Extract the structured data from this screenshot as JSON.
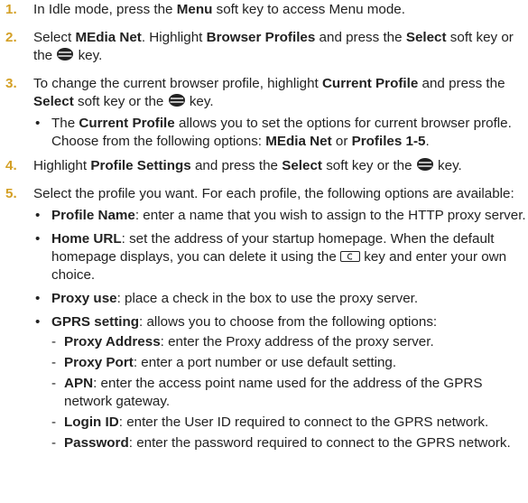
{
  "steps": [
    {
      "num": "1.",
      "t1": "In Idle mode, press the ",
      "b1": "Menu",
      "t2": " soft key to access Menu mode."
    },
    {
      "num": "2.",
      "t1": "Select ",
      "b1": "MEdia Net",
      "t2": ". Highlight ",
      "b2": "Browser Profiles",
      "t3": " and press the ",
      "b3": "Select",
      "t4": " soft key or the ",
      "t5": " key."
    },
    {
      "num": "3.",
      "t1": "To change the current browser profile, highlight ",
      "b1": "Current Profile",
      "t2": " and press the ",
      "b2": "Select",
      "t3": " soft key or the ",
      "t4": " key."
    },
    {
      "num": "4.",
      "t1": "Highlight ",
      "b1": "Profile Settings",
      "t2": " and press the ",
      "b2": "Select",
      "t3": " soft key or the ",
      "t4": " key."
    },
    {
      "num": "5.",
      "t1": "Select the profile you want. For each profile, the following options are available:"
    }
  ],
  "step3_bullet": {
    "t1": "The ",
    "b1": "Current Profile",
    "t2": " allows you to set the options for current browser profle. Choose from the following options: ",
    "b2": "MEdia Net",
    "t3": " or ",
    "b3": "Profiles 1-5",
    "t4": "."
  },
  "step5_bullets": [
    {
      "label": "Profile Name",
      "text": ": enter a name that you wish to assign to the HTTP proxy server."
    },
    {
      "label": "Home URL",
      "text": ": set the address of your startup homepage. When the default homepage displays, you can delete it using the ",
      "text2": " key and enter your own choice."
    },
    {
      "label": "Proxy use",
      "text": ": place a check in the box to use the proxy server."
    },
    {
      "label": "GPRS setting",
      "text": ": allows you to choose from the following options:"
    }
  ],
  "gprs_options": [
    {
      "label": "Proxy Address",
      "text": ": enter the Proxy address of the proxy server."
    },
    {
      "label": "Proxy Port",
      "text": ": enter a port number or use default setting."
    },
    {
      "label": "APN",
      "text": ": enter the access point name used for the address of the GPRS network gateway."
    },
    {
      "label": "Login ID",
      "text": ": enter the User ID required to connect to the GPRS network."
    },
    {
      "label": "Password",
      "text": ": enter the password required to connect to the GPRS network."
    }
  ],
  "icons": {
    "select_key": "nav-ok-key-icon",
    "clear_key": "clear-key-icon"
  }
}
